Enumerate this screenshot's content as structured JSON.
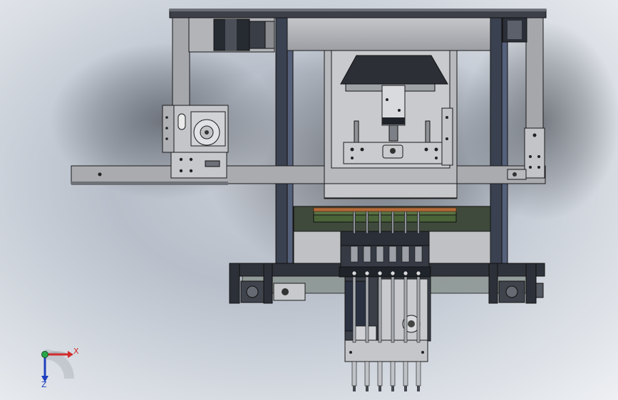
{
  "viewport": {
    "background_color": "#c4cad3",
    "shadow_color": "#3a3d44"
  },
  "colors": {
    "frame_steel": "#9a9ca0",
    "frame_dark": "#3c4250",
    "plate_light": "#b9bbbf",
    "plate_mid": "#8d9096",
    "edge": "#1a1a1a",
    "glass": "#7f8a86",
    "motor_dark": "#2a2e36",
    "copper": "#b36a3a",
    "green_board": "#4f6a3a"
  },
  "triad": {
    "x_label": "X",
    "z_label": "Z",
    "x_color": "#d22b2b",
    "z_color": "#1f3fbf",
    "y_color": "#2aa64a"
  },
  "nozzles": {
    "count": 6
  }
}
